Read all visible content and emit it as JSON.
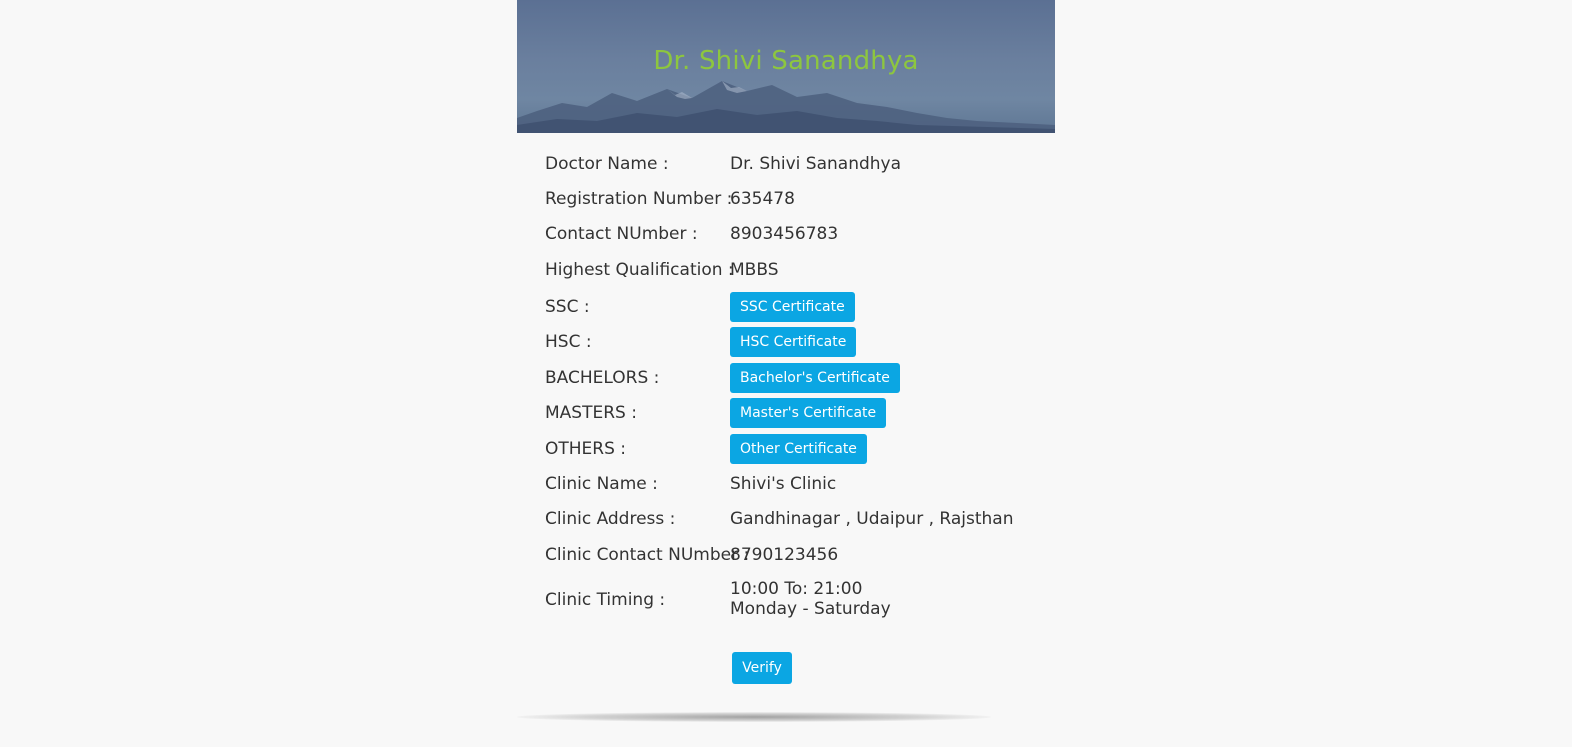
{
  "header": {
    "title": "Dr. Shivi Sanandhya"
  },
  "details": [
    {
      "label": "Doctor Name :",
      "value": "Dr. Shivi Sanandhya"
    },
    {
      "label": "Registration Number :",
      "value": "635478"
    },
    {
      "label": "Contact NUmber :",
      "value": "8903456783"
    },
    {
      "label": "Highest Qualification :",
      "value": "MBBS"
    }
  ],
  "certificates": [
    {
      "label": "SSC :",
      "button": "SSC Certificate"
    },
    {
      "label": "HSC :",
      "button": "HSC Certificate"
    },
    {
      "label": "BACHELORS :",
      "button": "Bachelor's Certificate"
    },
    {
      "label": "MASTERS :",
      "button": "Master's Certificate"
    },
    {
      "label": "OTHERS :",
      "button": "Other Certificate"
    }
  ],
  "clinic": [
    {
      "label": "Clinic Name :",
      "value": "Shivi's Clinic"
    },
    {
      "label": "Clinic Address :",
      "value": "Gandhinagar , Udaipur , Rajsthan"
    },
    {
      "label": "Clinic Contact NUmber :",
      "value": "8790123456"
    }
  ],
  "timing": {
    "label": "Clinic Timing :",
    "hours": "10:00 To: 21:00",
    "days": "Monday - Saturday"
  },
  "actions": {
    "verify_label": "Verify"
  },
  "colors": {
    "accent": "#0ba6e3",
    "title_green": "#8dc63f",
    "background": "#f8f8f8"
  }
}
